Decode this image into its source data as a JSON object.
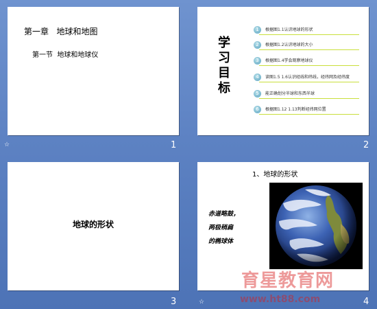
{
  "slides": [
    {
      "number": "1",
      "title": "第一章   地球和地图",
      "subtitle": "第一节  地球和地球仪"
    },
    {
      "number": "2",
      "vertical_title": [
        "学",
        "习",
        "目",
        "标"
      ],
      "goals": [
        {
          "index": "1",
          "text": "根据图1.1认识地球的形状"
        },
        {
          "index": "2",
          "text": "根据图1.2认识地球的大小"
        },
        {
          "index": "3",
          "text": "根据图1.4学会观察地球仪"
        },
        {
          "index": "4",
          "text": "读图1.5 1.6认识经线和纬线，经纬网及经纬度"
        },
        {
          "index": "5",
          "text": "能正确划分半球和东西半球"
        },
        {
          "index": "6",
          "text": "根据图1.12 1.13判断经纬网位置"
        }
      ]
    },
    {
      "number": "3",
      "title": "地球的形状"
    },
    {
      "number": "4",
      "title": "1、地球的形状",
      "caption_lines": [
        "赤道略鼓，",
        "两极稍扁",
        "的椭球体"
      ]
    }
  ],
  "slide_marker": "☆",
  "watermark": {
    "text": "育星教育网",
    "url": "www.ht88.com"
  },
  "colors": {
    "background": "#5d82c3",
    "goal_line": "#c9df3a",
    "bullet": "#5aa3c0"
  }
}
